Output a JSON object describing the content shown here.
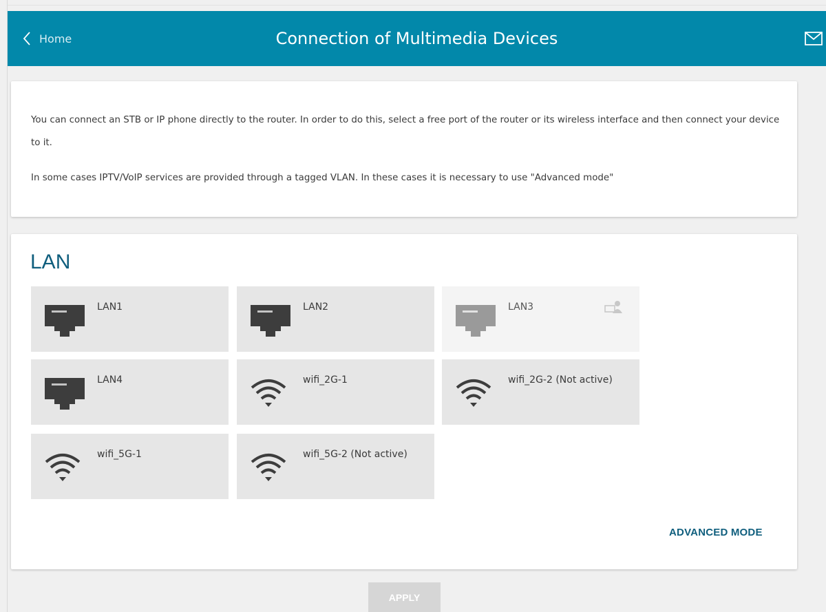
{
  "header": {
    "back_label": "Home",
    "title": "Connection of Multimedia Devices",
    "icons": {
      "back": "chevron-left-icon",
      "mail": "mail-icon"
    },
    "color": "#0288aa"
  },
  "intro": {
    "paragraph1": "You can connect an STB or IP phone directly to the router. In order to do this, select a free port of the router or its wireless interface and then connect your device to it.",
    "paragraph2": "In some cases IPTV/VoIP services are provided through a tagged VLAN. In these cases it is necessary to use \"Advanced mode\""
  },
  "lan": {
    "title": "LAN",
    "ports": [
      {
        "label": "LAN1",
        "type": "ethernet",
        "state": "available"
      },
      {
        "label": "LAN2",
        "type": "ethernet",
        "state": "available"
      },
      {
        "label": "LAN3",
        "type": "ethernet",
        "state": "in-use",
        "badge_icon": "computer-user-icon"
      },
      {
        "label": "LAN4",
        "type": "ethernet",
        "state": "available"
      },
      {
        "label": "wifi_2G-1",
        "type": "wifi",
        "state": "available"
      },
      {
        "label": "wifi_2G-2 (Not active)",
        "type": "wifi",
        "state": "available"
      },
      {
        "label": "wifi_5G-1",
        "type": "wifi",
        "state": "available"
      },
      {
        "label": "wifi_5G-2 (Not active)",
        "type": "wifi",
        "state": "available"
      }
    ],
    "advanced_mode_label": "ADVANCED MODE"
  },
  "actions": {
    "apply_label": "APPLY",
    "apply_enabled": false
  }
}
